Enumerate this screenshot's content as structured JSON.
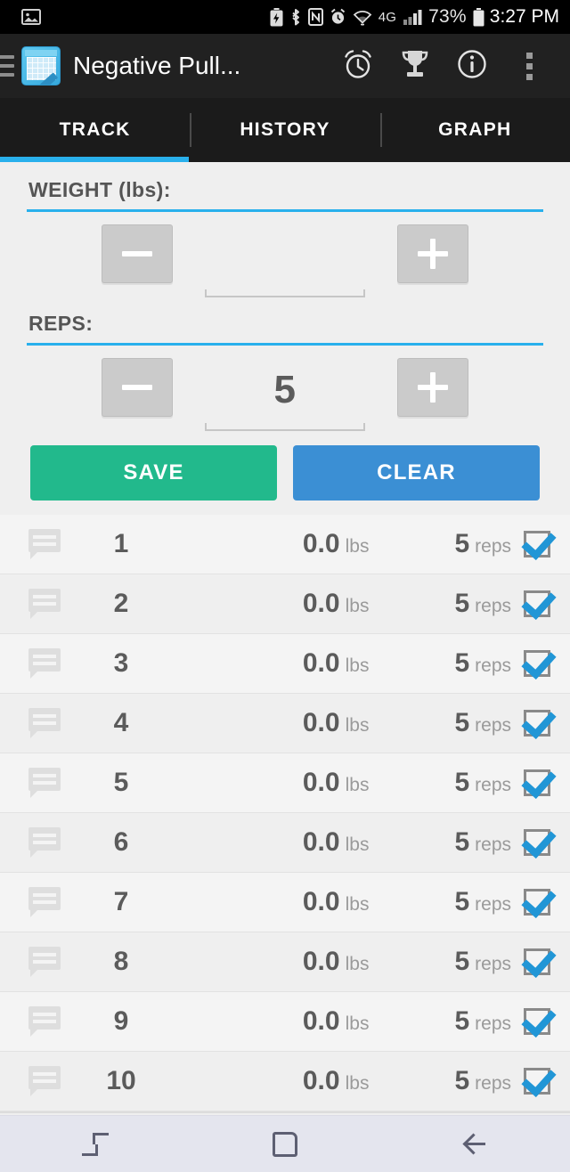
{
  "statusbar": {
    "left_icons": [
      "image-icon"
    ],
    "right_icons": [
      "battery-saver-icon",
      "bluetooth-icon",
      "nfc-icon",
      "alarm-icon",
      "wifi-icon",
      "4g-lte-icon",
      "signal-icon",
      "battery-icon"
    ],
    "network_label": "4G",
    "battery_percent": "73%",
    "time": "3:27 PM"
  },
  "toolbar": {
    "menu_icon": "hamburger-icon",
    "app_icon": "calendar-edit-icon",
    "title": "Negative Pull...",
    "actions": [
      {
        "name": "timer-button",
        "icon": "alarm-clock-icon"
      },
      {
        "name": "records-button",
        "icon": "trophy-icon"
      },
      {
        "name": "info-button",
        "icon": "info-circle-icon"
      },
      {
        "name": "overflow-button",
        "icon": "kebab-menu-icon"
      }
    ]
  },
  "tabs": {
    "items": [
      {
        "label": "TRACK",
        "selected": true
      },
      {
        "label": "HISTORY",
        "selected": false
      },
      {
        "label": "GRAPH",
        "selected": false
      }
    ],
    "indicator_color": "#29b0ec"
  },
  "form": {
    "weight": {
      "label": "WEIGHT (lbs):",
      "value": "",
      "decrement_label": "−",
      "increment_label": "+"
    },
    "reps": {
      "label": "REPS:",
      "value": "5",
      "decrement_label": "−",
      "increment_label": "+"
    }
  },
  "actions": {
    "save_label": "SAVE",
    "clear_label": "CLEAR",
    "save_color": "#22b98c",
    "clear_color": "#3b8fd4"
  },
  "setlist": {
    "weight_unit": "lbs",
    "reps_unit": "reps",
    "rows": [
      {
        "index": "1",
        "weight": "0.0",
        "unit": "lbs",
        "reps": "5",
        "reps_unit": "reps",
        "checked": true,
        "comment_icon": "comment-icon"
      },
      {
        "index": "2",
        "weight": "0.0",
        "unit": "lbs",
        "reps": "5",
        "reps_unit": "reps",
        "checked": true,
        "comment_icon": "comment-icon"
      },
      {
        "index": "3",
        "weight": "0.0",
        "unit": "lbs",
        "reps": "5",
        "reps_unit": "reps",
        "checked": true,
        "comment_icon": "comment-icon"
      },
      {
        "index": "4",
        "weight": "0.0",
        "unit": "lbs",
        "reps": "5",
        "reps_unit": "reps",
        "checked": true,
        "comment_icon": "comment-icon"
      },
      {
        "index": "5",
        "weight": "0.0",
        "unit": "lbs",
        "reps": "5",
        "reps_unit": "reps",
        "checked": true,
        "comment_icon": "comment-icon"
      },
      {
        "index": "6",
        "weight": "0.0",
        "unit": "lbs",
        "reps": "5",
        "reps_unit": "reps",
        "checked": true,
        "comment_icon": "comment-icon"
      },
      {
        "index": "7",
        "weight": "0.0",
        "unit": "lbs",
        "reps": "5",
        "reps_unit": "reps",
        "checked": true,
        "comment_icon": "comment-icon"
      },
      {
        "index": "8",
        "weight": "0.0",
        "unit": "lbs",
        "reps": "5",
        "reps_unit": "reps",
        "checked": true,
        "comment_icon": "comment-icon"
      },
      {
        "index": "9",
        "weight": "0.0",
        "unit": "lbs",
        "reps": "5",
        "reps_unit": "reps",
        "checked": true,
        "comment_icon": "comment-icon"
      },
      {
        "index": "10",
        "weight": "0.0",
        "unit": "lbs",
        "reps": "5",
        "reps_unit": "reps",
        "checked": true,
        "comment_icon": "comment-icon"
      }
    ]
  },
  "navbar": {
    "items": [
      {
        "name": "recents-button",
        "icon": "recents-icon"
      },
      {
        "name": "home-button",
        "icon": "home-square-icon"
      },
      {
        "name": "back-button",
        "icon": "back-arrow-icon"
      }
    ]
  }
}
